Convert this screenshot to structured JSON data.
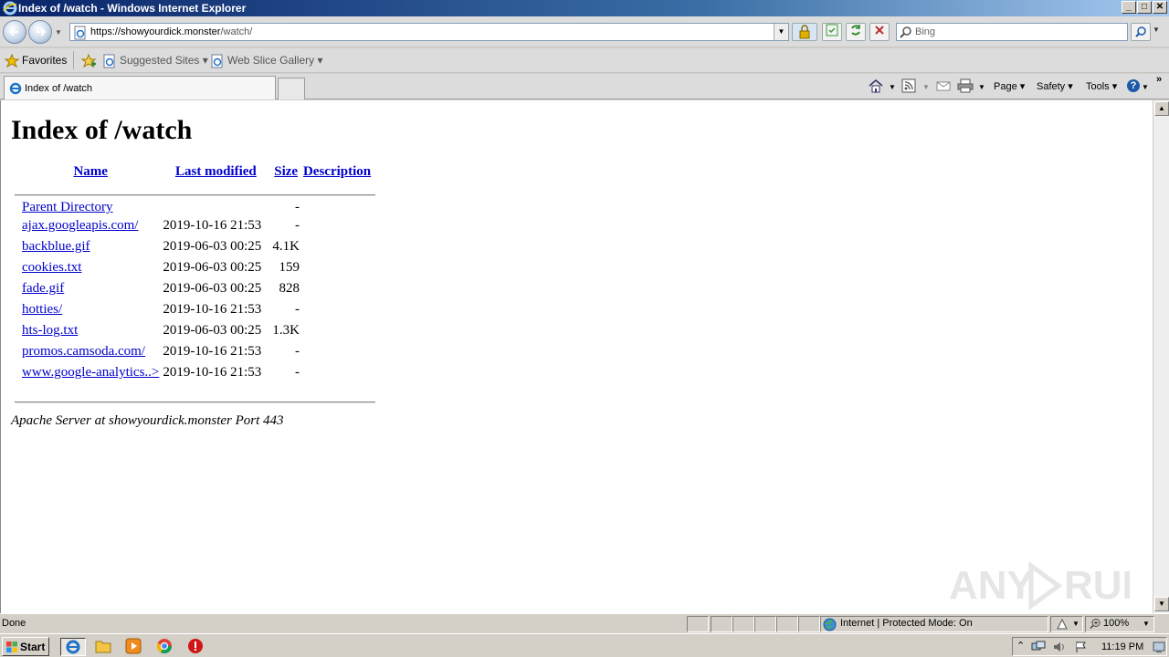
{
  "window": {
    "title": "Index of /watch - Windows Internet Explorer",
    "min": "_",
    "max": "□",
    "close": "✕"
  },
  "address_bar": {
    "url_host": "https://showyourdick.monster",
    "url_path": "/watch/",
    "search_placeholder": "Bing"
  },
  "favorites_bar": {
    "favorites_label": "Favorites",
    "suggested_sites": "Suggested Sites ▾",
    "web_slice_gallery": "Web Slice Gallery ▾"
  },
  "tab": {
    "label": "Index of /watch"
  },
  "command_bar": {
    "page": "Page ▾",
    "safety": "Safety ▾",
    "tools": "Tools ▾",
    "help": "?",
    "more": "»"
  },
  "page": {
    "heading": "Index of /watch",
    "columns": {
      "name": "Name",
      "last_modified": "Last modified",
      "size": "Size",
      "description": "Description"
    },
    "rows": [
      {
        "name": "Parent Directory",
        "modified": "",
        "size": "-"
      },
      {
        "name": "ajax.googleapis.com/",
        "modified": "2019-10-16 21:53",
        "size": "-"
      },
      {
        "name": "backblue.gif",
        "modified": "2019-06-03 00:25",
        "size": "4.1K"
      },
      {
        "name": "cookies.txt",
        "modified": "2019-06-03 00:25",
        "size": "159"
      },
      {
        "name": "fade.gif",
        "modified": "2019-06-03 00:25",
        "size": "828"
      },
      {
        "name": "hotties/",
        "modified": "2019-10-16 21:53",
        "size": "-"
      },
      {
        "name": "hts-log.txt",
        "modified": "2019-06-03 00:25",
        "size": "1.3K"
      },
      {
        "name": "promos.camsoda.com/",
        "modified": "2019-10-16 21:53",
        "size": "-"
      },
      {
        "name": "www.google-analytics..>",
        "modified": "2019-10-16 21:53",
        "size": "-"
      }
    ],
    "server_signature": "Apache Server at showyourdick.monster Port 443",
    "watermark": "ANY RUN"
  },
  "status_bar": {
    "status": "Done",
    "zone": "Internet | Protected Mode: On",
    "zoom": "100%"
  },
  "taskbar": {
    "start": "Start",
    "clock": "11:19 PM"
  }
}
